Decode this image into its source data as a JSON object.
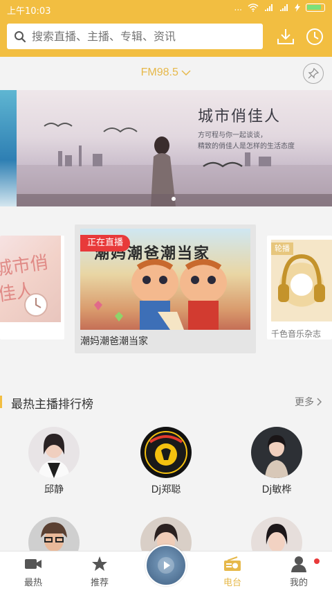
{
  "status_bar": {
    "time": "上午10:03",
    "dots": "..."
  },
  "search": {
    "placeholder": "搜索直播、主播、专辑、资讯"
  },
  "header_icons": {
    "download": "download-icon",
    "history": "history-icon"
  },
  "fm": {
    "label": "FM98.5",
    "dropdown_icon": "chevron-down-icon",
    "pin_icon": "pin-icon"
  },
  "banner": {
    "title": "城市俏佳人",
    "subtitle_line1": "方可程与你一起谈谈，",
    "subtitle_line2": "精致的俏佳人是怎样的生活态度"
  },
  "cards": {
    "left_art": "城市俏佳人",
    "center": {
      "badge": "正在直播",
      "art_text": "潮妈潮爸潮当家",
      "caption": "潮妈潮爸潮当家"
    },
    "right": {
      "badge": "轮播",
      "caption": "千色音乐杂志"
    }
  },
  "section": {
    "title": "最热主播排行榜",
    "more": "更多"
  },
  "hosts": [
    {
      "name": "邱静"
    },
    {
      "name": "Dj郑聪"
    },
    {
      "name": "Dj敏桦"
    }
  ],
  "nav": [
    {
      "label": "最热",
      "icon": "video-camera-icon"
    },
    {
      "label": "推荐",
      "icon": "star-icon"
    },
    {
      "label": "电台",
      "icon": "radio-icon"
    },
    {
      "label": "我的",
      "icon": "user-icon"
    }
  ],
  "colors": {
    "brand": "#f2be41",
    "accent_text": "#e6b84a",
    "live_red": "#e83a3a"
  }
}
